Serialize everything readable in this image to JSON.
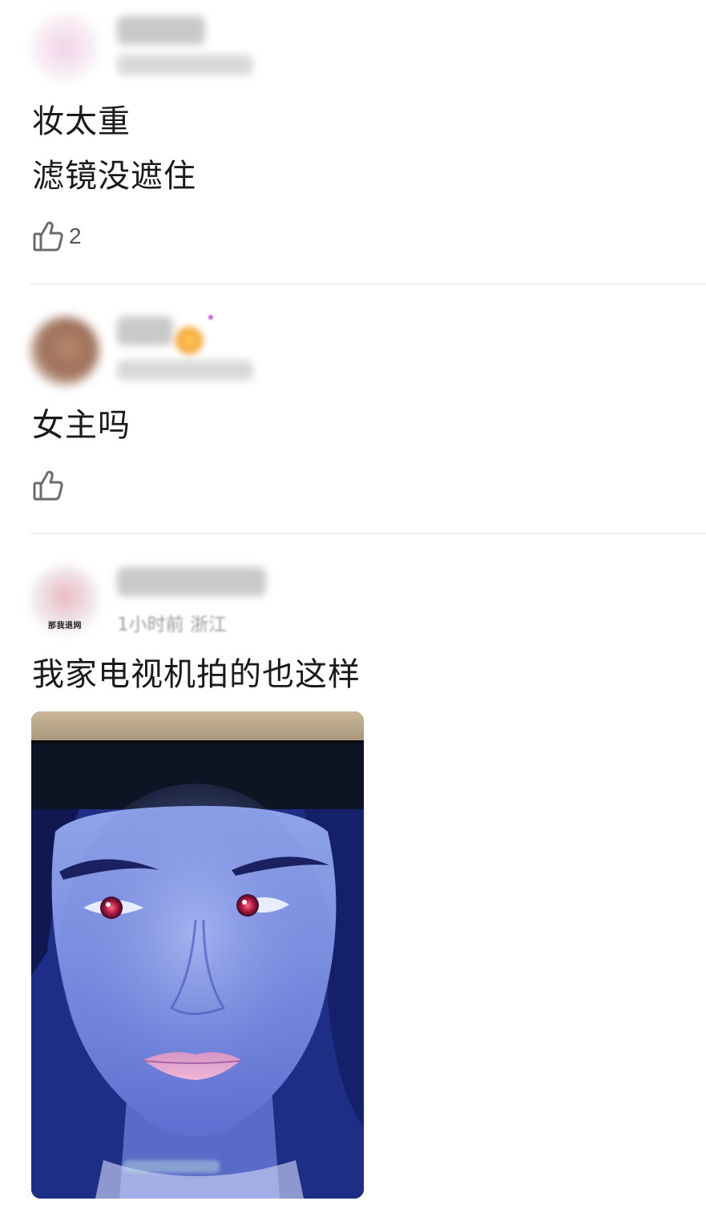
{
  "comments": [
    {
      "text_lines": [
        "妆太重",
        "滤镜没遮住"
      ],
      "like_count": "2",
      "like_icon": "thumbs-up-icon"
    },
    {
      "text_lines": [
        "女主吗"
      ],
      "like_count": "",
      "like_icon": "thumbs-up-icon"
    },
    {
      "avatar_tag": "那我退网",
      "meta": "1小时前 浙江",
      "text_lines": [
        "我家电视机拍的也这样"
      ],
      "has_image": true
    }
  ],
  "colors": {
    "text": "#1a1a1a",
    "meta": "#9a9a9a",
    "divider": "#e3e3e3",
    "icon": "#6b6b6b"
  }
}
